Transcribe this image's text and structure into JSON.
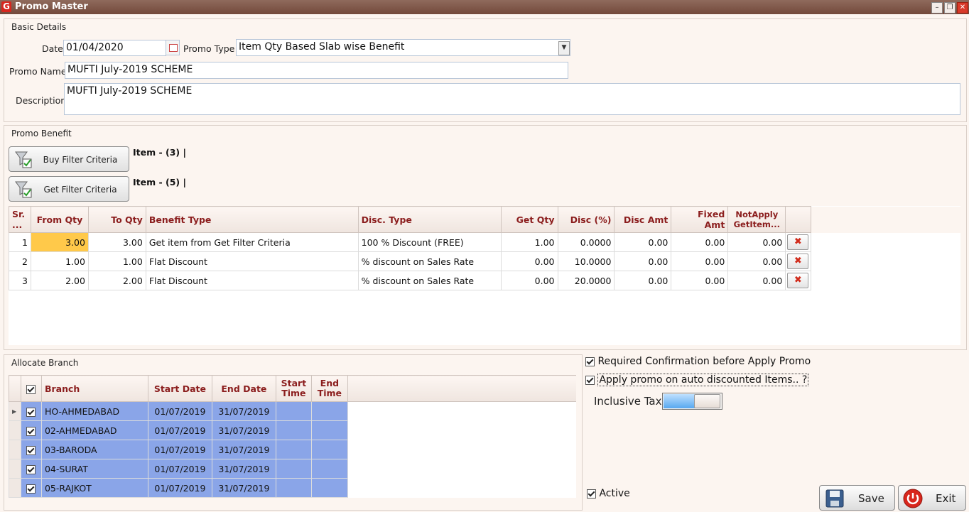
{
  "window": {
    "title": "Promo Master",
    "logo": "G"
  },
  "basic": {
    "title": "Basic Details",
    "date_label": "Date",
    "date_value": "01/04/2020",
    "promo_type_label": "Promo Type",
    "promo_type_value": "Item Qty Based Slab wise Benefit",
    "promo_name_label": "Promo Name",
    "promo_name_value": "MUFTI July-2019 SCHEME",
    "description_label": "Description",
    "description_value": "MUFTI July-2019 SCHEME"
  },
  "benefit": {
    "title": "Promo Benefit",
    "buy_filter_label": "Buy Filter Criteria",
    "buy_item_text": "Item - (3) |",
    "get_filter_label": "Get Filter Criteria",
    "get_item_text": "Item - (5) |",
    "columns": [
      "Sr. ...",
      "From Qty",
      "To Qty",
      "Benefit Type",
      "Disc. Type",
      "Get Qty",
      "Disc (%)",
      "Disc Amt",
      "Fixed Amt",
      "NotApply GetItem..."
    ],
    "rows": [
      {
        "sr": "1",
        "from": "3.00",
        "to": "3.00",
        "benefit": "Get item from Get Filter Criteria",
        "disc_type": "100 % Discount (FREE)",
        "get_qty": "1.00",
        "disc_pct": "0.0000",
        "disc_amt": "0.00",
        "fixed_amt": "0.00",
        "notapply": "0.00"
      },
      {
        "sr": "2",
        "from": "1.00",
        "to": "1.00",
        "benefit": "Flat Discount",
        "disc_type": "% discount on Sales Rate",
        "get_qty": "0.00",
        "disc_pct": "10.0000",
        "disc_amt": "0.00",
        "fixed_amt": "0.00",
        "notapply": "0.00"
      },
      {
        "sr": "3",
        "from": "2.00",
        "to": "2.00",
        "benefit": "Flat Discount",
        "disc_type": "% discount on Sales Rate",
        "get_qty": "0.00",
        "disc_pct": "20.0000",
        "disc_amt": "0.00",
        "fixed_amt": "0.00",
        "notapply": "0.00"
      }
    ],
    "delete_icon": "x-icon"
  },
  "allocate": {
    "title": "Allocate Branch",
    "columns": [
      "Branch",
      "Start Date",
      "End Date",
      "Start Time",
      "End Time"
    ],
    "rows": [
      {
        "branch": "HO-AHMEDABAD",
        "start": "01/07/2019",
        "end": "31/07/2019"
      },
      {
        "branch": "02-AHMEDABAD",
        "start": "01/07/2019",
        "end": "31/07/2019"
      },
      {
        "branch": "03-BARODA",
        "start": "01/07/2019",
        "end": "31/07/2019"
      },
      {
        "branch": "04-SURAT",
        "start": "01/07/2019",
        "end": "31/07/2019"
      },
      {
        "branch": "05-RAJKOT",
        "start": "01/07/2019",
        "end": "31/07/2019"
      }
    ]
  },
  "options": {
    "required_confirmation": "Required Confirmation before Apply Promo",
    "apply_auto_discounted": "Apply promo on auto discounted Items.. ?",
    "inclusive_tax": "Inclusive Tax",
    "active": "Active"
  },
  "actions": {
    "save": "Save",
    "exit": "Exit"
  },
  "colors": {
    "header_text": "#8b1d1d",
    "selected_row": "#8aa5e8",
    "title_bar": "#7a4f40",
    "highlight_cell": "#ffc94a"
  }
}
